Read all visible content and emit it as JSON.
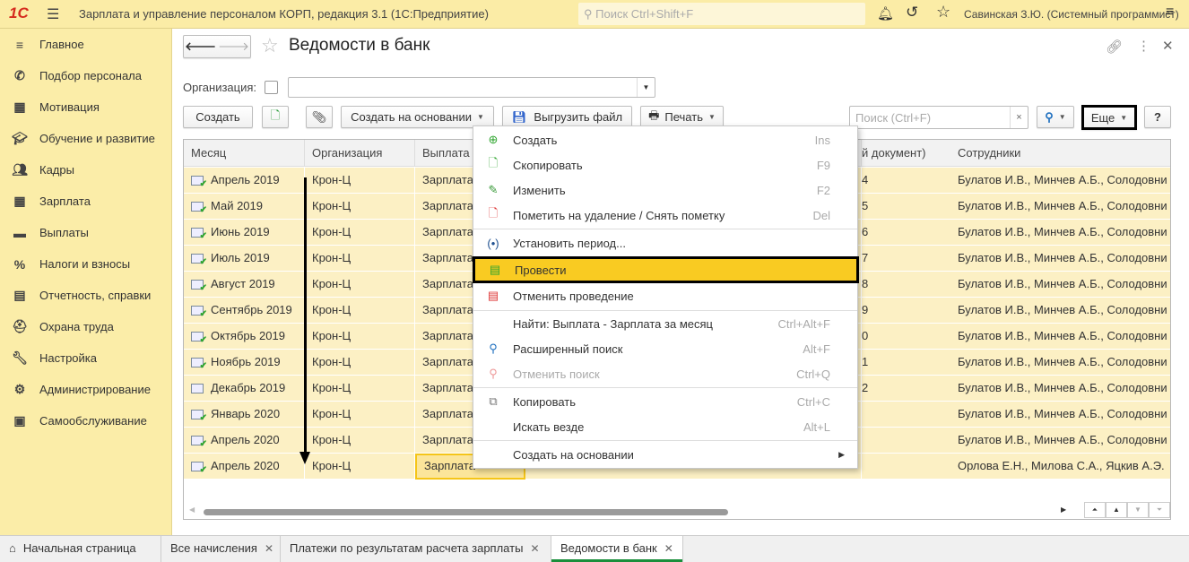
{
  "app": {
    "title": "Зарплата и управление персоналом КОРП, редакция 3.1  (1С:Предприятие)",
    "search_placeholder": "Поиск Ctrl+Shift+F",
    "user": "Савинская З.Ю. (Системный программист)",
    "logo": "1С"
  },
  "sidebar": {
    "items": [
      {
        "label": "Главное",
        "icon": "menu-lines-icon"
      },
      {
        "label": "Подбор персонала",
        "icon": "phone-icon"
      },
      {
        "label": "Мотивация",
        "icon": "gift-icon"
      },
      {
        "label": "Обучение и развитие",
        "icon": "graduation-cap-icon"
      },
      {
        "label": "Кадры",
        "icon": "people-icon"
      },
      {
        "label": "Зарплата",
        "icon": "calculator-icon"
      },
      {
        "label": "Выплаты",
        "icon": "wallet-icon"
      },
      {
        "label": "Налоги и взносы",
        "icon": "percent-icon"
      },
      {
        "label": "Отчетность, справки",
        "icon": "reports-icon"
      },
      {
        "label": "Охрана труда",
        "icon": "helmet-icon"
      },
      {
        "label": "Настройка",
        "icon": "wrench-icon"
      },
      {
        "label": "Администрирование",
        "icon": "gear-icon"
      },
      {
        "label": "Самообслуживание",
        "icon": "id-card-icon"
      }
    ]
  },
  "form": {
    "title": "Ведомости в банк",
    "org_label": "Организация:",
    "org_value": ""
  },
  "toolbar": {
    "create": "Создать",
    "create_based": "Создать на основании",
    "export_file": "Выгрузить файл",
    "print": "Печать",
    "search_placeholder": "Поиск (Ctrl+F)",
    "more": "Еще",
    "help": "?"
  },
  "table": {
    "headers": [
      "Месяц",
      "Организация",
      "Выплата",
      "",
      "й документ)",
      "Сотрудники"
    ],
    "rows": [
      {
        "month": "Апрель 2019",
        "org": "Крон-Ц",
        "payment": "Зарплата",
        "doc_tail": "4",
        "employees": "Булатов И.В., Минчев А.Б., Солодовни",
        "posted": true
      },
      {
        "month": "Май 2019",
        "org": "Крон-Ц",
        "payment": "Зарплата",
        "doc_tail": "5",
        "employees": "Булатов И.В., Минчев А.Б., Солодовни",
        "posted": true
      },
      {
        "month": "Июнь 2019",
        "org": "Крон-Ц",
        "payment": "Зарплата",
        "doc_tail": "6",
        "employees": "Булатов И.В., Минчев А.Б., Солодовни",
        "posted": true
      },
      {
        "month": "Июль 2019",
        "org": "Крон-Ц",
        "payment": "Зарплата",
        "doc_tail": "7",
        "employees": "Булатов И.В., Минчев А.Б., Солодовни",
        "posted": true
      },
      {
        "month": "Август 2019",
        "org": "Крон-Ц",
        "payment": "Зарплата",
        "doc_tail": "8",
        "employees": "Булатов И.В., Минчев А.Б., Солодовни",
        "posted": true
      },
      {
        "month": "Сентябрь 2019",
        "org": "Крон-Ц",
        "payment": "Зарплата",
        "doc_tail": "9",
        "employees": "Булатов И.В., Минчев А.Б., Солодовни",
        "posted": true
      },
      {
        "month": "Октябрь 2019",
        "org": "Крон-Ц",
        "payment": "Зарплата",
        "doc_tail": "0",
        "employees": "Булатов И.В., Минчев А.Б., Солодовни",
        "posted": true
      },
      {
        "month": "Ноябрь 2019",
        "org": "Крон-Ц",
        "payment": "Зарплата",
        "doc_tail": "1",
        "employees": "Булатов И.В., Минчев А.Б., Солодовни",
        "posted": true
      },
      {
        "month": "Декабрь 2019",
        "org": "Крон-Ц",
        "payment": "Зарплата",
        "doc_tail": "2",
        "employees": "Булатов И.В., Минчев А.Б., Солодовни",
        "posted": false
      },
      {
        "month": "Январь 2020",
        "org": "Крон-Ц",
        "payment": "Зарплата",
        "doc_tail": "",
        "employees": "Булатов И.В., Минчев А.Б., Солодовни",
        "posted": true
      },
      {
        "month": "Апрель 2020",
        "org": "Крон-Ц",
        "payment": "Зарплата",
        "doc_tail": "",
        "employees": "Булатов И.В., Минчев А.Б., Солодовни",
        "posted": true
      },
      {
        "month": "Апрель 2020",
        "org": "Крон-Ц",
        "payment": "Зарплата",
        "doc_tail": "",
        "employees": "Орлова Е.Н., Милова С.А., Яцкив А.Э.",
        "posted": true
      }
    ]
  },
  "menu": {
    "items": [
      {
        "label": "Создать",
        "shortcut": "Ins",
        "icon": "plus-circle-icon"
      },
      {
        "label": "Скопировать",
        "shortcut": "F9",
        "icon": "copy-doc-icon"
      },
      {
        "label": "Изменить",
        "shortcut": "F2",
        "icon": "pencil-icon"
      },
      {
        "label": "Пометить на удаление / Снять пометку",
        "shortcut": "Del",
        "icon": "delete-mark-icon"
      },
      {
        "label": "Установить период...",
        "shortcut": "",
        "icon": "period-icon"
      },
      {
        "label": "Провести",
        "shortcut": "",
        "icon": "post-icon",
        "highlighted": true
      },
      {
        "label": "Отменить проведение",
        "shortcut": "",
        "icon": "unpost-icon"
      },
      {
        "label": "Найти: Выплата - Зарплата за месяц",
        "shortcut": "Ctrl+Alt+F",
        "icon": ""
      },
      {
        "label": "Расширенный поиск",
        "shortcut": "Alt+F",
        "icon": "search-icon"
      },
      {
        "label": "Отменить поиск",
        "shortcut": "Ctrl+Q",
        "icon": "cancel-search-icon",
        "disabled": true
      },
      {
        "label": "Копировать",
        "shortcut": "Ctrl+C",
        "icon": "copy-icon"
      },
      {
        "label": "Искать везде",
        "shortcut": "Alt+L",
        "icon": ""
      },
      {
        "label": "Создать на основании",
        "shortcut": "",
        "icon": "",
        "submenu": true
      }
    ]
  },
  "tabs": [
    {
      "label": "Начальная страница",
      "icon": "home-icon"
    },
    {
      "label": "Все начисления"
    },
    {
      "label": "Платежи по результатам расчета зарплаты"
    },
    {
      "label": "Ведомости в банк",
      "active": true
    }
  ],
  "colors": {
    "topbar": "#fbeca6",
    "sidebar": "#fbeda8",
    "row": "#fcf0c4",
    "highlight": "#f9cb22",
    "accent_green": "#1a8f3c",
    "logo_red": "#d52b1e"
  }
}
